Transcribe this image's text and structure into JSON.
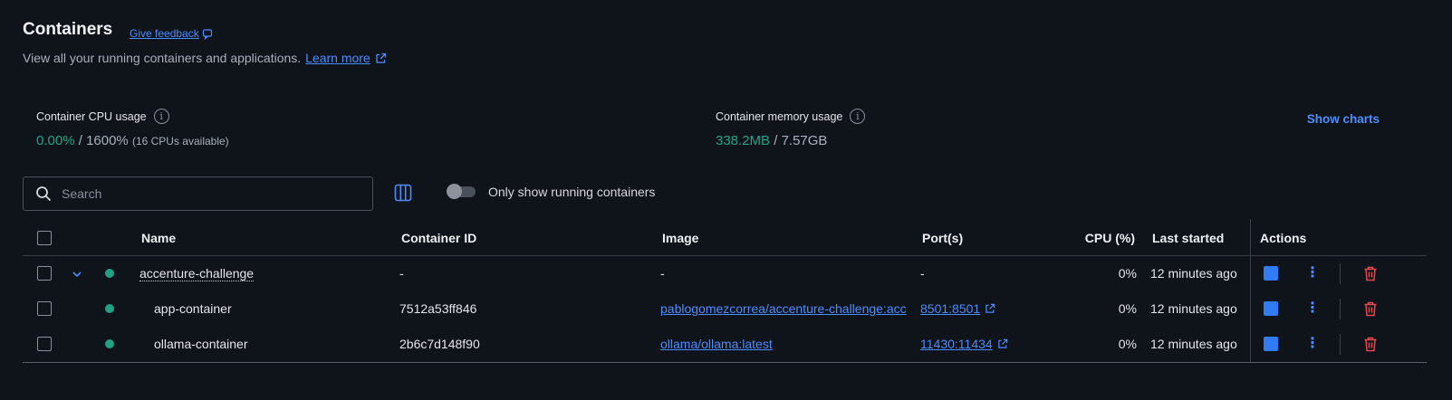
{
  "header": {
    "title": "Containers",
    "feedback_label": "Give feedback",
    "subtitle": "View all your running containers and applications.",
    "learn_more": "Learn more"
  },
  "stats": {
    "cpu": {
      "label": "Container CPU usage",
      "used": "0.00%",
      "separator": " / ",
      "total": "1600%",
      "note": "(16 CPUs available)"
    },
    "memory": {
      "label": "Container memory usage",
      "used": "338.2MB",
      "separator": " / ",
      "total": "7.57GB"
    },
    "show_charts": "Show charts"
  },
  "toolbar": {
    "search_placeholder": "Search",
    "toggle_label": "Only show running containers",
    "toggle_on": false
  },
  "table": {
    "columns": {
      "name": "Name",
      "container_id": "Container ID",
      "image": "Image",
      "ports": "Port(s)",
      "cpu": "CPU (%)",
      "last_started": "Last started",
      "actions": "Actions"
    },
    "rows": [
      {
        "name": "accenture-challenge",
        "container_id": "-",
        "image": "-",
        "ports": "-",
        "cpu": "0%",
        "last_started": "12 minutes ago"
      },
      {
        "name": "app-container",
        "container_id": "7512a53ff846",
        "image": "pablogomezcorrea/accenture-challenge:acc",
        "ports": "8501:8501",
        "cpu": "0%",
        "last_started": "12 minutes ago"
      },
      {
        "name": "ollama-container",
        "container_id": "2b6c7d148f90",
        "image": "ollama/ollama:latest",
        "ports": "11430:11434",
        "cpu": "0%",
        "last_started": "12 minutes ago"
      }
    ]
  },
  "colors": {
    "background": "#0f131a",
    "accent": "#4c8dff",
    "running": "#20a084",
    "delete": "#e5484d"
  }
}
